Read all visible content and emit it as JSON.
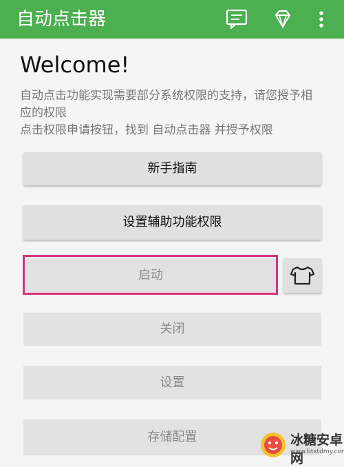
{
  "appbar": {
    "title": "自动点击器",
    "bg_color": "#4caf50",
    "icons": [
      "chat-icon",
      "diamond-icon",
      "more-vert-icon"
    ]
  },
  "main": {
    "welcome": "Welcome!",
    "desc_line1": "自动点击功能实现需要部分系统权限的支持，请您授予相应的权限",
    "desc_line2": "点击权限申请按钮，找到 自动点击器 并授予权限"
  },
  "buttons": {
    "guide": "新手指南",
    "accessibility": "设置辅助功能权限",
    "start": "启动",
    "close": "关闭",
    "settings": "设置",
    "save_config": "存储配置"
  },
  "accent": {
    "highlight_color": "#d6337a"
  },
  "watermark": {
    "title": "冰糖安卓网",
    "url": "www.btxtdmy.com"
  }
}
